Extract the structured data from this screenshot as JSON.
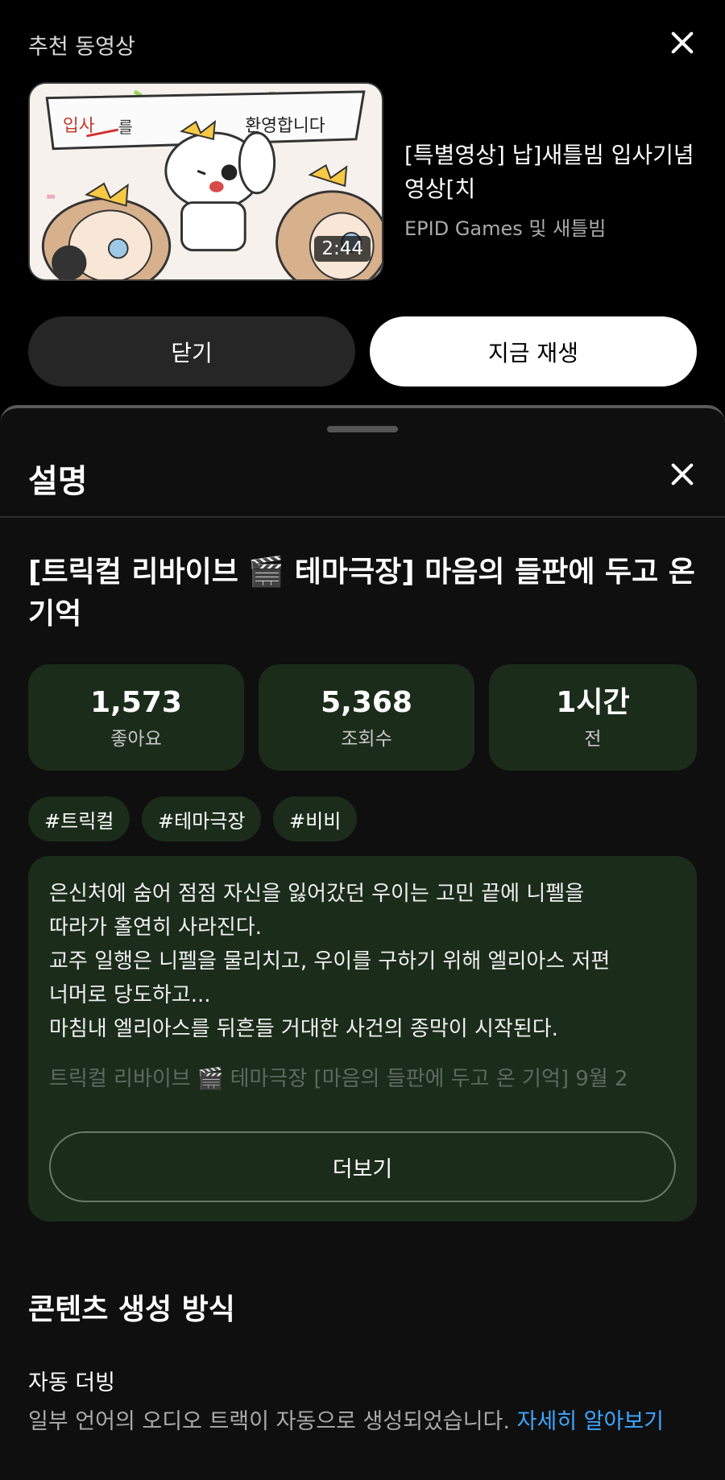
{
  "recommended": {
    "header": "추천 동영상",
    "video_title": "[특별영상] 납]새틀빔 입사기념 영상[치",
    "channel": "EPID Games 및 새틀빔",
    "duration": "2:44",
    "thumbnail_banner_text_1": "입사",
    "thumbnail_banner_text_2": "를",
    "thumbnail_banner_text_3": "환영합니다",
    "close_label": "닫기",
    "play_label": "지금 재생"
  },
  "sheet": {
    "title": "설명",
    "video_title": "[트릭컬 리바이브 🎬 테마극장] 마음의 들판에 두고 온 기억",
    "stats": [
      {
        "value": "1,573",
        "label": "좋아요"
      },
      {
        "value": "5,368",
        "label": "조회수"
      },
      {
        "value": "1시간",
        "label": "전"
      }
    ],
    "tags": [
      "#트릭컬",
      "#테마극장",
      "#비비"
    ],
    "description": "은신처에 숨어 점점 자신을 잃어갔던 우이는 고민 끝에 니펠을\n따라가 홀연히 사라진다.\n교주 일행은 니펠을 물리치고, 우이를 구하기 위해 엘리아스 저편\n너머로 당도하고...\n마침내 엘리아스를 뒤흔들 거대한 사건의 종막이 시작된다.",
    "description_faded": "트릭컬 리바이브 🎬 테마극장 [마음의 들판에 두고 온 기억] 9월 2",
    "more_label": "더보기",
    "content_section": {
      "heading": "콘텐츠 생성 방식",
      "item_title": "자동 더빙",
      "item_text": "일부 언어의 오디오 트랙이 자동으로 생성되었습니다. ",
      "link_text": "자세히 알아보기"
    }
  },
  "colors": {
    "accent_link": "#3ea6ff",
    "card_bg": "#1b2c1b",
    "sheet_bg": "#0f0f0f"
  }
}
